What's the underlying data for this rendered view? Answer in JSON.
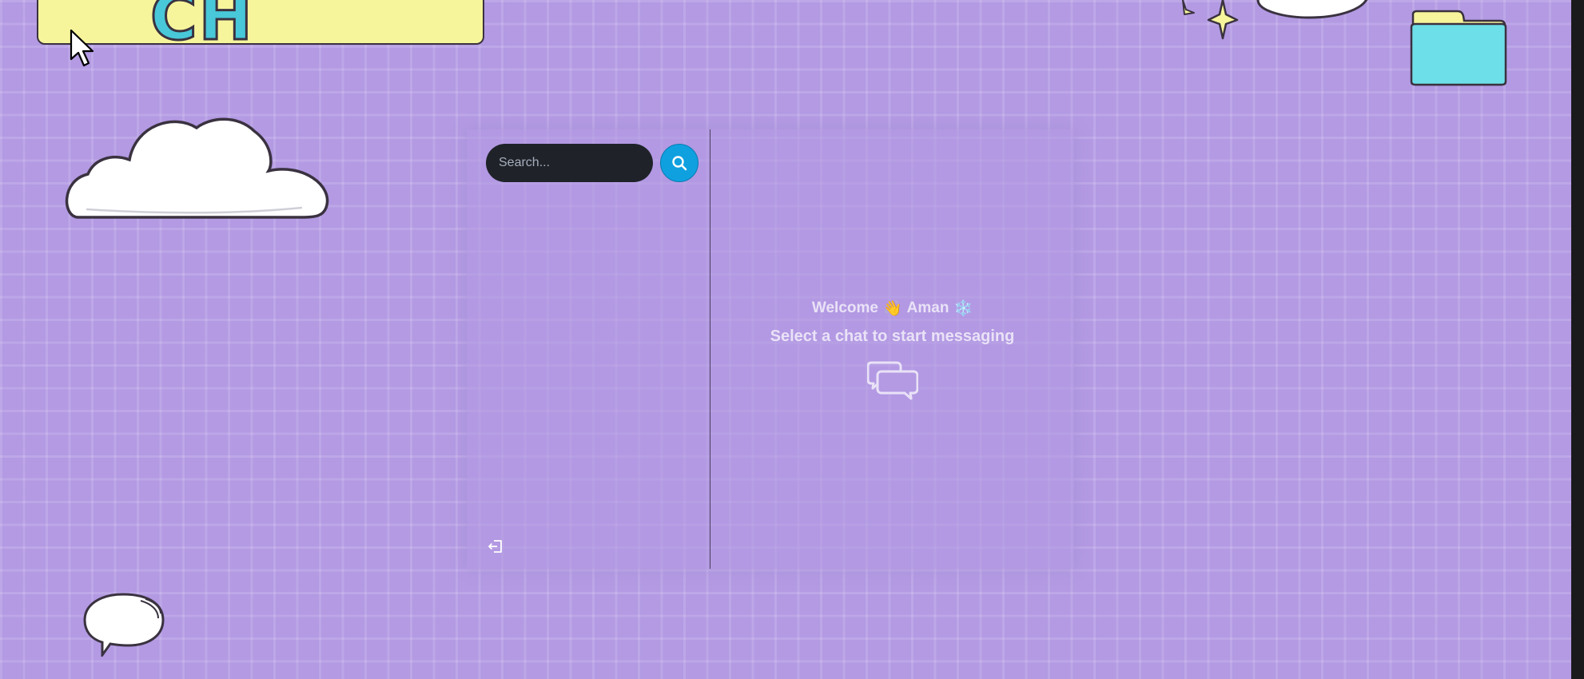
{
  "sign": {
    "text": "CH"
  },
  "search": {
    "placeholder": "Search...",
    "value": ""
  },
  "welcome": {
    "greeting": "Welcome",
    "wave_emoji": "👋",
    "name": "Aman",
    "snow_emoji": "❄️",
    "subtitle": "Select a chat to start messaging"
  },
  "icons": {
    "search": "search-icon",
    "logout": "logout-icon",
    "chat": "chat-bubbles-icon"
  },
  "colors": {
    "background": "#b39ae3",
    "search_button": "#0fa0e0",
    "search_input": "#1f2329",
    "sign": "#f7f59b",
    "folder": "#6ddfe8"
  }
}
